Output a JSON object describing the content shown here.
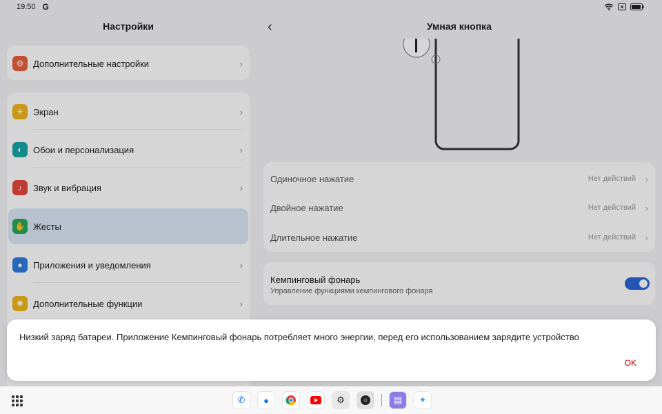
{
  "status_bar": {
    "time": "19:50",
    "g_icon": "G"
  },
  "settings": {
    "title": "Настройки",
    "top_item": {
      "label": "Дополнительные настройки",
      "icon": "orange-gear-icon"
    },
    "items": [
      {
        "label": "Экран",
        "icon": "sun-icon"
      },
      {
        "label": "Обои и персонализация",
        "icon": "palette-icon"
      },
      {
        "label": "Звук и вибрация",
        "icon": "speaker-icon"
      },
      {
        "label": "Жесты",
        "icon": "hand-icon"
      },
      {
        "label": "Приложения и уведомления",
        "icon": "apps-icon"
      },
      {
        "label": "Дополнительные функции",
        "icon": "bulb-icon"
      }
    ]
  },
  "detail": {
    "title": "Умная кнопка",
    "actions": [
      {
        "label": "Одиночное нажатие",
        "value": "Нет действий"
      },
      {
        "label": "Двойное нажатие",
        "value": "Нет действий"
      },
      {
        "label": "Длительное нажатие",
        "value": "Нет действий"
      }
    ],
    "lamp": {
      "title": "Кемпинговый фонарь",
      "subtitle": "Управление функциями кемпингового фонаря",
      "enabled": true
    }
  },
  "dialog": {
    "message": "Низкий заряд батареи. Приложение Кемпинговый фонарь потребляет много энергии, перед его использованием зарядите устройство",
    "ok_label": "OK"
  },
  "dock": {
    "apps": [
      "phone-icon",
      "messages-icon",
      "chrome-icon",
      "youtube-icon",
      "settings-icon",
      "camera-icon",
      "notes-icon",
      "assistant-icon"
    ]
  },
  "colors": {
    "accent": "#2a63d6",
    "ok_text": "#b00000",
    "selected_bg": "#dce7f7"
  }
}
